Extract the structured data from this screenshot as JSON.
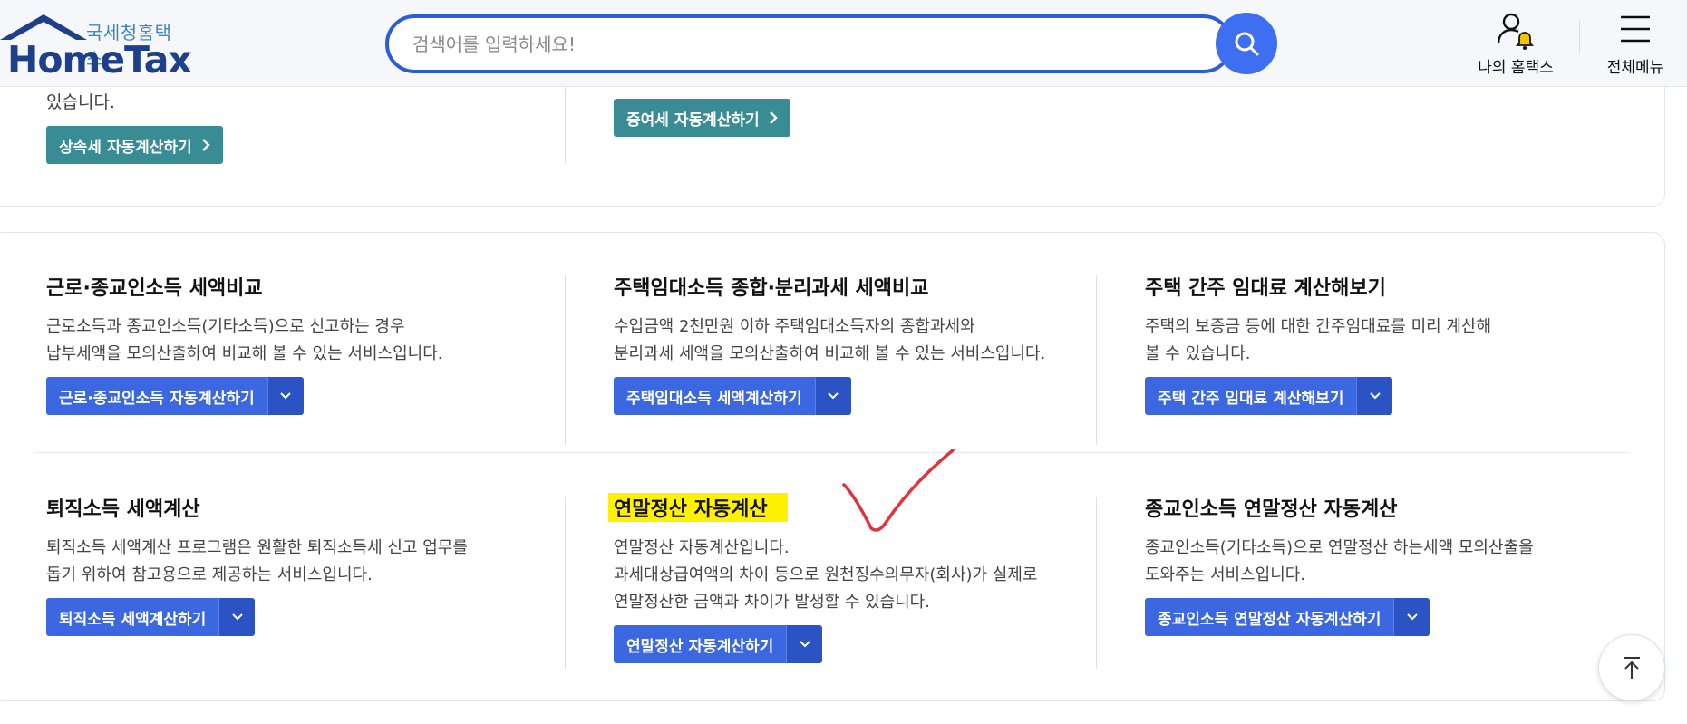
{
  "header": {
    "logo_sub": "국세청홈택스",
    "logo_main": "HomeTax",
    "search_placeholder": "검색어를 입력하세요!",
    "my_hometax": "나의 홈택스",
    "all_menu": "전체메뉴"
  },
  "top_card": {
    "fragment_text": "있습니다.",
    "inheritance_button": "상속세 자동계산하기",
    "gift_button": "증여세 자동계산하기"
  },
  "items": [
    {
      "title": "근로·종교인소득 세액비교",
      "desc": [
        "근로소득과 종교인소득(기타소득)으로 신고하는 경우",
        "납부세액을 모의산출하여 비교해 볼 수 있는 서비스입니다."
      ],
      "button": "근로·종교인소득 자동계산하기"
    },
    {
      "title": "주택임대소득 종합·분리과세 세액비교",
      "desc": [
        "수입금액 2천만원 이하 주택임대소득자의 종합과세와",
        "분리과세 세액을 모의산출하여 비교해 볼 수 있는 서비스입니다."
      ],
      "button": "주택임대소득 세액계산하기"
    },
    {
      "title": "주택 간주 임대료 계산해보기",
      "desc": [
        "주택의 보증금 등에 대한 간주임대료를 미리 계산해",
        "볼 수 있습니다."
      ],
      "button": "주택 간주 임대료 계산해보기"
    },
    {
      "title": "퇴직소득 세액계산",
      "desc": [
        "퇴직소득 세액계산 프로그램은 원활한 퇴직소득세 신고 업무를",
        "돕기 위하여 참고용으로 제공하는 서비스입니다."
      ],
      "button": "퇴직소득 세액계산하기"
    },
    {
      "title": "연말정산 자동계산",
      "desc": [
        "연말정산 자동계산입니다.",
        "과세대상급여액의 차이 등으로 원천징수의무자(회사)가 실제로",
        "연말정산한 금액과 차이가 발생할 수 있습니다."
      ],
      "button": "연말정산 자동계산하기",
      "highlight_color": "#fff200"
    },
    {
      "title": "종교인소득 연말정산 자동계산",
      "desc": [
        "종교인소득(기타소득)으로 연말정산 하는세액 모의산출을",
        "도와주는 서비스입니다."
      ],
      "button": "종교인소득 연말정산 자동계산하기"
    }
  ],
  "colors": {
    "primary_blue": "#3b68e0",
    "teal": "#3a8c94",
    "highlight": "#fff200",
    "annotation_red": "#e0343c"
  },
  "icons": [
    "home-roof-icon",
    "search-icon",
    "user-bell-icon",
    "hamburger-menu-icon",
    "chevron-right-icon",
    "chevron-down-icon",
    "arrow-up-icon",
    "red-checkmark-annotation"
  ]
}
